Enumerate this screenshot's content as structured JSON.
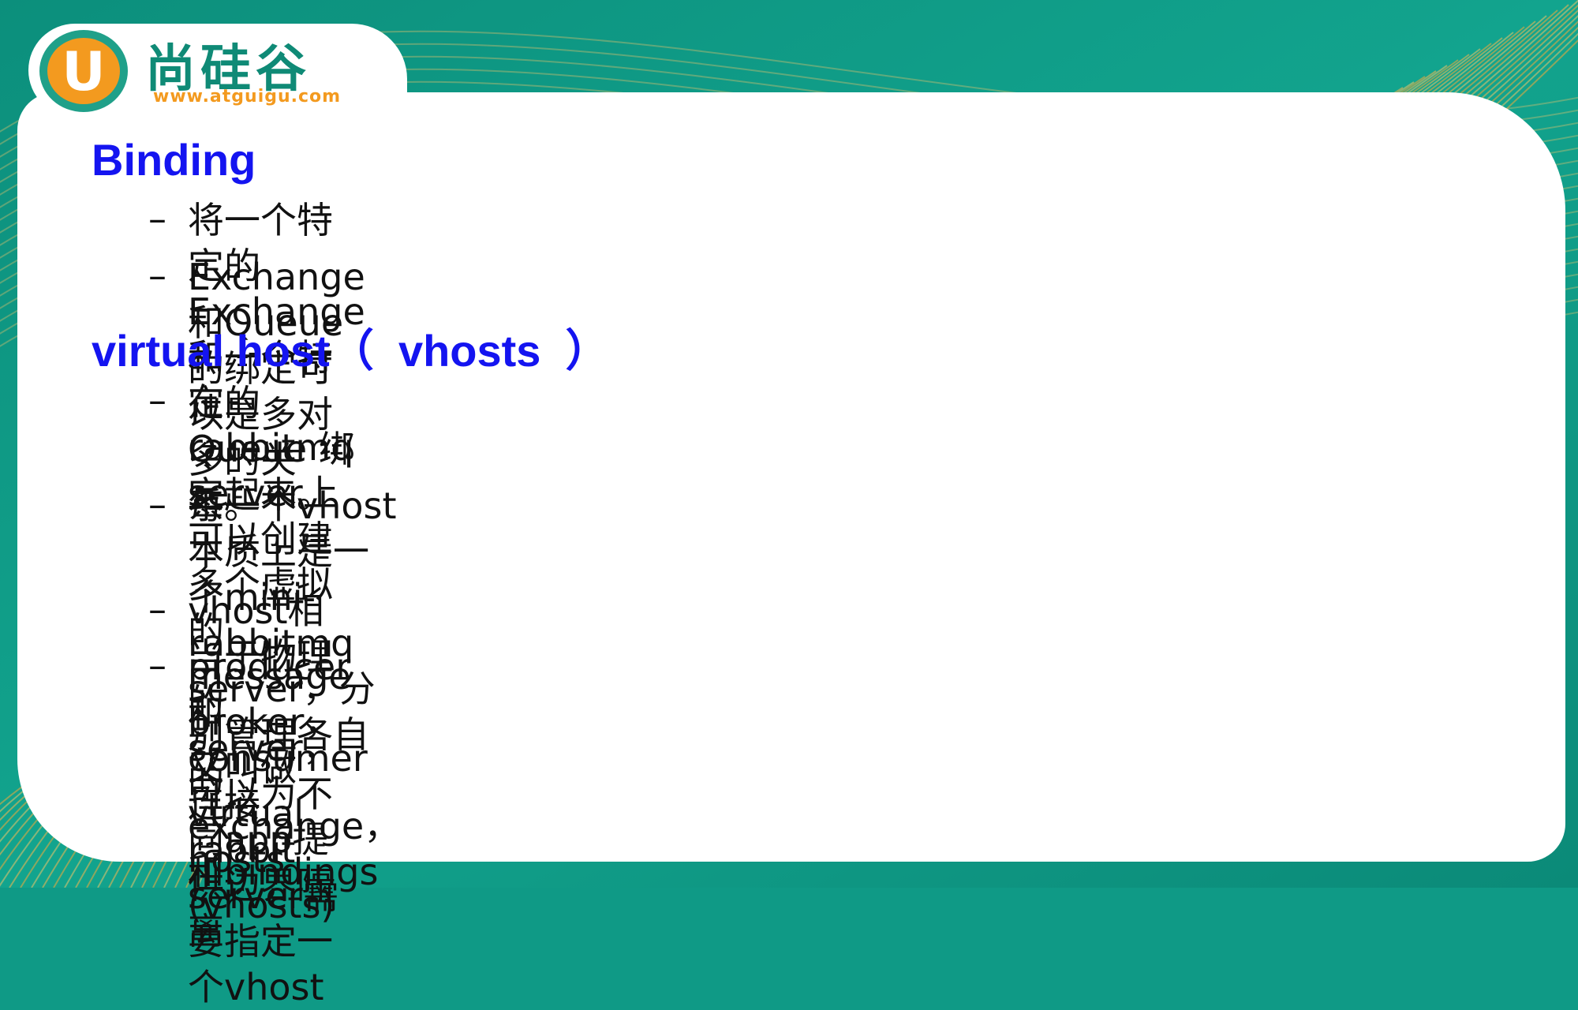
{
  "logo": {
    "badge_letter": "U",
    "brand_name": "尚硅谷",
    "url": "www.atguigu.com"
  },
  "slide": {
    "bullet_marker": "–",
    "sections": [
      {
        "heading": "Binding",
        "bullets": [
          "将一个特定的 Exchange 和一个特定的 Queue 绑定起来。",
          "Exchange 和Queue的绑定可以是多对多的关系。"
        ]
      },
      {
        "heading": "virtual host（  vhosts  ）",
        "bullets": [
          "在rabbitmq server上可以创建多个虚拟的message broker，又叫做\nvirtual hosts (vhosts)",
          "每一个vhost本质上是一个mini-rabbitmq server，分别管理各自的\nexchange，和bindings",
          "vhost相当于物理的server，可以为不同app提供边界隔离",
          "producer和consumer连接rabbit server需要指定一个vhost"
        ]
      }
    ]
  },
  "colors": {
    "background_teal": "#0f9a86",
    "accent_orange": "#f39a1f",
    "heading_blue": "#1414f0",
    "body_text": "#111111"
  }
}
